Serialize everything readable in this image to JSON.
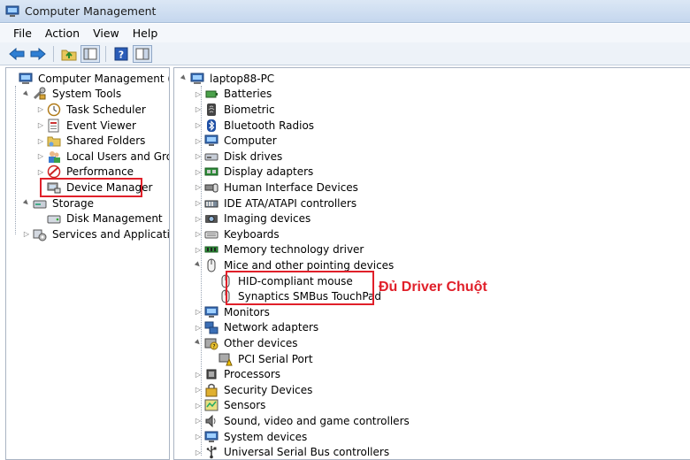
{
  "window": {
    "title": "Computer Management"
  },
  "menu": [
    "File",
    "Action",
    "View",
    "Help"
  ],
  "toolbar": {
    "icons": [
      "back-arrow-icon",
      "forward-arrow-icon",
      "up-folder-icon",
      "show-hide-tree-icon",
      "help-icon",
      "console-icon"
    ]
  },
  "left_tree": [
    {
      "label": "Computer Management (Local",
      "level": 0,
      "expander": "",
      "icon": "computer-mgmt-icon"
    },
    {
      "label": "System Tools",
      "level": 1,
      "expander": "▲",
      "icon": "tools-icon"
    },
    {
      "label": "Task Scheduler",
      "level": 2,
      "expander": "▷",
      "icon": "clock-icon"
    },
    {
      "label": "Event Viewer",
      "level": 2,
      "expander": "▷",
      "icon": "event-viewer-icon"
    },
    {
      "label": "Shared Folders",
      "level": 2,
      "expander": "▷",
      "icon": "shared-folder-icon"
    },
    {
      "label": "Local Users and Groups",
      "level": 2,
      "expander": "▷",
      "icon": "users-icon"
    },
    {
      "label": "Performance",
      "level": 2,
      "expander": "▷",
      "icon": "performance-icon"
    },
    {
      "label": "Device Manager",
      "level": 2,
      "expander": "",
      "icon": "device-manager-icon"
    },
    {
      "label": "Storage",
      "level": 1,
      "expander": "▲",
      "icon": "storage-icon"
    },
    {
      "label": "Disk Management",
      "level": 2,
      "expander": "",
      "icon": "disk-icon"
    },
    {
      "label": "Services and Applications",
      "level": 1,
      "expander": "▷",
      "icon": "services-icon"
    }
  ],
  "right_tree": [
    {
      "label": "laptop88-PC",
      "level": 0,
      "expander": "▲",
      "icon": "computer-icon"
    },
    {
      "label": "Batteries",
      "level": 1,
      "expander": "▷",
      "icon": "battery-icon"
    },
    {
      "label": "Biometric",
      "level": 1,
      "expander": "▷",
      "icon": "biometric-icon"
    },
    {
      "label": "Bluetooth Radios",
      "level": 1,
      "expander": "▷",
      "icon": "bluetooth-icon"
    },
    {
      "label": "Computer",
      "level": 1,
      "expander": "▷",
      "icon": "monitor-icon"
    },
    {
      "label": "Disk drives",
      "level": 1,
      "expander": "▷",
      "icon": "disk-drive-icon"
    },
    {
      "label": "Display adapters",
      "level": 1,
      "expander": "▷",
      "icon": "display-adapter-icon"
    },
    {
      "label": "Human Interface Devices",
      "level": 1,
      "expander": "▷",
      "icon": "hid-icon"
    },
    {
      "label": "IDE ATA/ATAPI controllers",
      "level": 1,
      "expander": "▷",
      "icon": "ide-icon"
    },
    {
      "label": "Imaging devices",
      "level": 1,
      "expander": "▷",
      "icon": "camera-icon"
    },
    {
      "label": "Keyboards",
      "level": 1,
      "expander": "▷",
      "icon": "keyboard-icon"
    },
    {
      "label": "Memory technology driver",
      "level": 1,
      "expander": "▷",
      "icon": "memory-icon"
    },
    {
      "label": "Mice and other pointing devices",
      "level": 1,
      "expander": "▲",
      "icon": "mouse-icon"
    },
    {
      "label": "HID-compliant mouse",
      "level": 2,
      "expander": "",
      "icon": "mouse-icon"
    },
    {
      "label": "Synaptics SMBus TouchPad",
      "level": 2,
      "expander": "",
      "icon": "mouse-icon"
    },
    {
      "label": "Monitors",
      "level": 1,
      "expander": "▷",
      "icon": "monitor-icon"
    },
    {
      "label": "Network adapters",
      "level": 1,
      "expander": "▷",
      "icon": "network-icon"
    },
    {
      "label": "Other devices",
      "level": 1,
      "expander": "▲",
      "icon": "unknown-device-icon"
    },
    {
      "label": "PCI Serial Port",
      "level": 2,
      "expander": "",
      "icon": "warning-device-icon"
    },
    {
      "label": "Processors",
      "level": 1,
      "expander": "▷",
      "icon": "processor-icon"
    },
    {
      "label": "Security Devices",
      "level": 1,
      "expander": "▷",
      "icon": "security-icon"
    },
    {
      "label": "Sensors",
      "level": 1,
      "expander": "▷",
      "icon": "sensor-icon"
    },
    {
      "label": "Sound, video and game controllers",
      "level": 1,
      "expander": "▷",
      "icon": "sound-icon"
    },
    {
      "label": "System devices",
      "level": 1,
      "expander": "▷",
      "icon": "system-device-icon"
    },
    {
      "label": "Universal Serial Bus controllers",
      "level": 1,
      "expander": "▷",
      "icon": "usb-icon"
    }
  ],
  "annotation": {
    "text": "Đủ Driver Chuột"
  },
  "colors": {
    "highlight": "#e0202a",
    "titlebar": "#c5d7ee"
  }
}
